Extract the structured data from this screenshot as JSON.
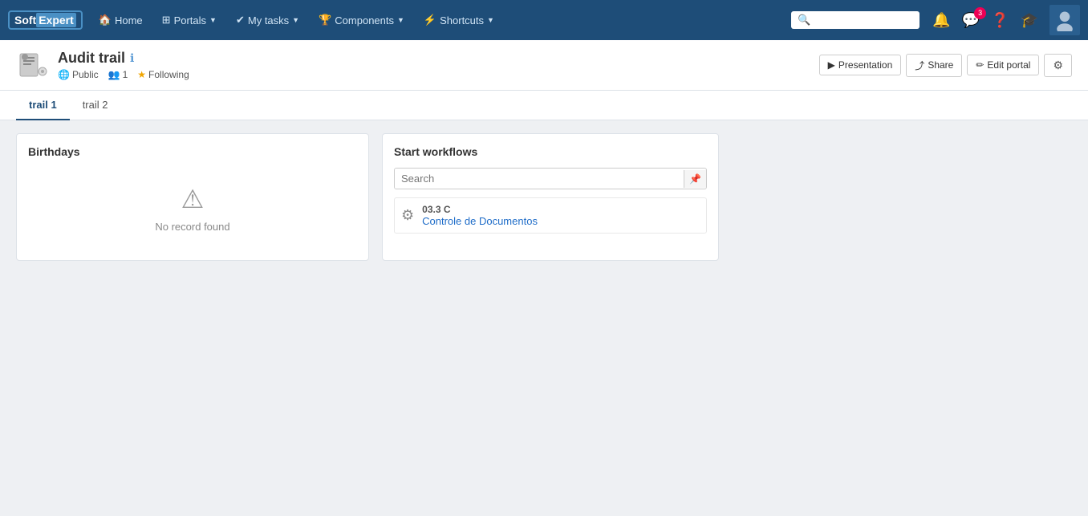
{
  "app": {
    "logo_soft": "Soft",
    "logo_expert": "Expert"
  },
  "topnav": {
    "home_label": "Home",
    "portals_label": "Portals",
    "mytasks_label": "My tasks",
    "components_label": "Components",
    "shortcuts_label": "Shortcuts",
    "search_placeholder": "",
    "notification_count": "3"
  },
  "page_header": {
    "title": "Audit trail",
    "visibility": "Public",
    "followers": "1",
    "following_label": "Following",
    "presentation_label": "Presentation",
    "share_label": "Share",
    "edit_portal_label": "Edit portal"
  },
  "tabs": [
    {
      "id": "trail1",
      "label": "trail 1",
      "active": true
    },
    {
      "id": "trail2",
      "label": "trail 2",
      "active": false
    }
  ],
  "widgets": {
    "birthdays": {
      "title": "Birthdays",
      "no_record": "No record found"
    },
    "start_workflows": {
      "title": "Start workflows",
      "search_placeholder": "Search",
      "items": [
        {
          "code": "03.3 C",
          "name": "Controle de Documentos"
        }
      ]
    }
  }
}
